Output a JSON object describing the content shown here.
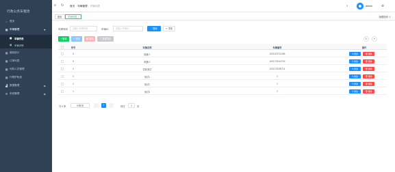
{
  "sidebar": {
    "title": "行政公务车租赁",
    "items": [
      {
        "label": "首页",
        "icon": "home-icon",
        "glyph": "⌂"
      },
      {
        "label": "车辆管理",
        "icon": "grid-icon",
        "glyph": "▦"
      },
      {
        "label": "营收统计",
        "icon": "grid-icon",
        "glyph": "▦"
      },
      {
        "label": "订单列表",
        "icon": "grid-icon",
        "glyph": "▦"
      },
      {
        "label": "司机人员管理",
        "icon": "grid-icon",
        "glyph": "▦"
      },
      {
        "label": "行程护轨迹",
        "icon": "grid-icon",
        "glyph": "▦"
      },
      {
        "label": "数据管理",
        "icon": "chart-icon",
        "glyph": "▟"
      },
      {
        "label": "系统管理",
        "icon": "gear-icon",
        "glyph": "⚙"
      }
    ],
    "subitems": [
      {
        "label": "车辆列表",
        "icon": "grid-icon",
        "glyph": "▦"
      },
      {
        "label": "车辆详情",
        "icon": "grid-icon",
        "glyph": "▦"
      }
    ]
  },
  "navbar": {
    "hamburger_glyph": "≡",
    "refresh_glyph": "↻",
    "breadcrumb": [
      "首页",
      "车辆管理",
      "车辆列表"
    ],
    "search_glyph": "⌕",
    "fullscreen_glyph": "⤢",
    "username": "admin",
    "gear_glyph": "⚙"
  },
  "tags": {
    "items": [
      "首页",
      "车辆列表"
    ],
    "close_glyph": "×",
    "hide_search": "隐藏搜索 ⇅"
  },
  "search": {
    "field1_label": "车牌号码",
    "field1_placeholder": "请输入车牌号码",
    "field2_label": "车辆ID",
    "field2_placeholder": "请输入车辆ID",
    "search_button": "⌕ 搜索",
    "reset_button": "↻ 重置"
  },
  "toolbar": {
    "add": "+ 新增",
    "edit": "✎ 修改",
    "delete": "🗑 删除",
    "export": "⇩ 批量导出",
    "refresh_glyph": "↻",
    "columns_glyph": "≡"
  },
  "table": {
    "headers": [
      "序号",
      "车辆名称",
      "车辆编号",
      "操作"
    ],
    "rows": [
      {
        "id": "6",
        "name": "机器人",
        "code": "1001103712456"
      },
      {
        "id": "5",
        "name": "机器人",
        "code": "1001723114716"
      },
      {
        "id": "4",
        "name": "四轮测试",
        "code": "1001376335711"
      },
      {
        "id": "3",
        "name": "测试1",
        "code": "2"
      },
      {
        "id": "2",
        "name": "测试2",
        "code": "2"
      },
      {
        "id": "1",
        "name": "测试3",
        "code": "2"
      }
    ],
    "edit_label": "✎ 修改",
    "delete_label": "🗑 删除"
  },
  "pagination": {
    "total": "共 6 条",
    "page_size": "10条/页",
    "prev": "‹",
    "current": "1",
    "next": "›",
    "goto_label": "前往",
    "goto_value": "1",
    "page_suffix": "页"
  }
}
